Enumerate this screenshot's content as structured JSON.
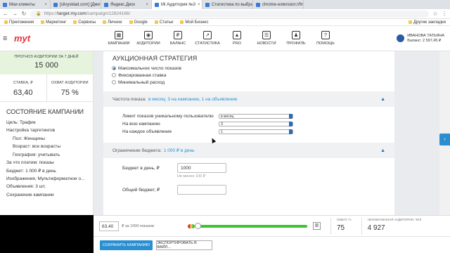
{
  "browser": {
    "tabs": [
      {
        "title": "Мои клиенты"
      },
      {
        "title": "[slivysklad.com] [Дмитр..."
      },
      {
        "title": "Яндекс.Диск"
      },
      {
        "title": "Мі Аудитория №3"
      },
      {
        "title": "Статистика по выбран..."
      },
      {
        "title": "chrome-extension://fmjd..."
      }
    ],
    "url_prefix": "https://",
    "url_host": "target.my.com",
    "url_path": "/campaign/12824166/",
    "bookmarks": [
      "Приложения",
      "Маркетинг",
      "Сервисы",
      "Личное",
      "Google",
      "Статьи",
      "Мой Бизнес"
    ],
    "other_bookmarks": "Другие закладки"
  },
  "nav": {
    "logo": "myt",
    "items": [
      {
        "label": "Кампании",
        "icon": "campaigns-icon",
        "glyph": "▦"
      },
      {
        "label": "Аудитории",
        "icon": "audiences-icon",
        "glyph": "◉"
      },
      {
        "label": "Баланс",
        "icon": "balance-icon",
        "glyph": "₽"
      },
      {
        "label": "Статистика",
        "icon": "statistics-icon",
        "glyph": "↗"
      },
      {
        "label": "Pro",
        "icon": "pro-icon",
        "glyph": "▲"
      },
      {
        "label": "Новости",
        "icon": "news-icon",
        "glyph": "☰"
      },
      {
        "label": "Профиль",
        "icon": "profile-icon",
        "glyph": "♟"
      },
      {
        "label": "Помощь",
        "icon": "help-icon",
        "glyph": "?"
      }
    ],
    "user_name": "ИВАНОВА ТАТЬЯНА",
    "user_balance": "Баланс: 2 597,45 ₽"
  },
  "sidebar": {
    "forecast_label": "ПРОГНОЗ АУДИТОРИИ ЗА 7 ДНЕЙ",
    "forecast_value": "15 000",
    "rate_label": "СТАВКА, ₽",
    "rate_value": "63,40",
    "reach_label": "ОХВАТ АУДИТОРИИ",
    "reach_value": "75 %",
    "status_title": "СОСТОЯНИЕ КАМПАНИИ",
    "items": [
      {
        "text": "Цель: Трафик",
        "indent": false
      },
      {
        "text": "Настройка таргетингов",
        "indent": false
      },
      {
        "text": "Пол: Женщины",
        "indent": true
      },
      {
        "text": "Возраст: все возрасты",
        "indent": true
      },
      {
        "text": "География: учитывать",
        "indent": true
      },
      {
        "text": "За что платим: показы",
        "indent": false
      },
      {
        "text": "Бюджет: 1 000 ₽ в день",
        "indent": false
      },
      {
        "text": "Изображения, Мультиформатное о...",
        "indent": false
      },
      {
        "text": "Объявления: 3 шт.",
        "indent": false
      },
      {
        "text": "Сохранение кампании",
        "indent": false
      }
    ]
  },
  "strategy": {
    "title": "АУКЦИОННАЯ СТРАТЕГИЯ",
    "options": [
      {
        "label": "Максимальное число показов",
        "selected": true
      },
      {
        "label": "Фиксированная ставка",
        "selected": false
      },
      {
        "label": "Минимальный расход",
        "selected": false
      }
    ]
  },
  "frequency": {
    "bar_key": "Частота показа:",
    "bar_value": "в месяц: 3 на кампанию, 1 на объявление",
    "rows": [
      {
        "label": "Лимит показов уникальному пользователю",
        "value": "в месяц"
      },
      {
        "label": "На всю кампанию",
        "value": "3"
      },
      {
        "label": "На каждое объявление",
        "value": "1"
      }
    ]
  },
  "budget": {
    "bar_key": "Ограничение бюджета:",
    "bar_value": "1 000 ₽ в день",
    "daily_label": "Бюджет в день, ₽",
    "daily_value": "1000",
    "daily_hint": "Не менее 100 ₽",
    "total_label": "Общий бюджет, ₽",
    "total_value": ""
  },
  "bottom": {
    "price_value": "63.40",
    "price_label": "₽ за 1000 показов",
    "reach_label": "ОХВАТ, %",
    "reach_value": "75",
    "unused_label": "НЕОХВАЧЕННАЯ АУДИТОРИЯ, ЧЕЛ",
    "unused_value": "4 927",
    "save_label": "СОХРАНИТЬ КАМПАНИЮ",
    "export_label": "ЭКСПОРТИРОВАТЬ В ФАЙЛ..."
  },
  "colors": {
    "accent": "#2a8fd0",
    "brand": "#e5303a",
    "forecast_bg": "#e6f4dd"
  }
}
